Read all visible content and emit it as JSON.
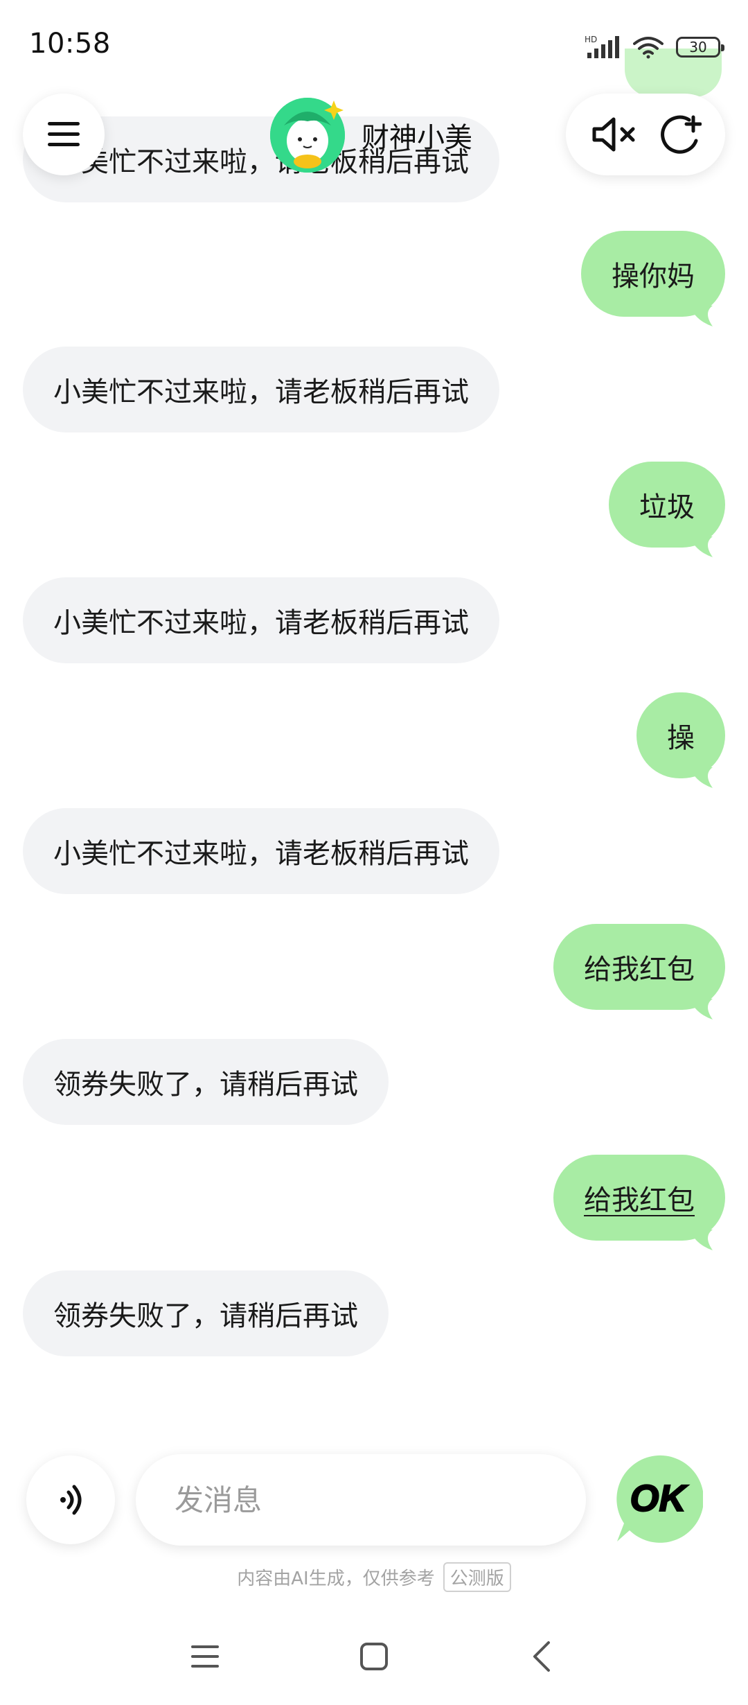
{
  "status_bar": {
    "time": "10:58",
    "network_label": "HD",
    "battery": "30"
  },
  "header": {
    "title": "财神小美"
  },
  "messages": [
    {
      "role": "bot",
      "text": "小美忙不过来啦，请老板稍后再试"
    },
    {
      "role": "user",
      "text": "操你妈"
    },
    {
      "role": "bot",
      "text": "小美忙不过来啦，请老板稍后再试"
    },
    {
      "role": "user",
      "text": "垃圾"
    },
    {
      "role": "bot",
      "text": "小美忙不过来啦，请老板稍后再试"
    },
    {
      "role": "user",
      "text": "操"
    },
    {
      "role": "bot",
      "text": "小美忙不过来啦，请老板稍后再试"
    },
    {
      "role": "user",
      "text": "给我红包"
    },
    {
      "role": "bot",
      "text": "领券失败了，请稍后再试"
    },
    {
      "role": "user",
      "text": "给我红包"
    },
    {
      "role": "bot",
      "text": "领券失败了，请稍后再试"
    }
  ],
  "input": {
    "placeholder": "发消息"
  },
  "ok_button": {
    "label": "OK"
  },
  "footer": {
    "disclaimer": "内容由AI生成，仅供参考",
    "badge": "公测版"
  },
  "colors": {
    "user_bubble": "#a8eca4",
    "bot_bubble": "#f2f3f5",
    "avatar": "#34d98a"
  },
  "icons": {
    "menu": "menu-icon",
    "mute": "speaker-mute-icon",
    "new_chat": "new-chat-icon",
    "voice": "voice-wave-icon",
    "nav_recents": "recents-icon",
    "nav_home": "home-icon",
    "nav_back": "back-icon"
  }
}
